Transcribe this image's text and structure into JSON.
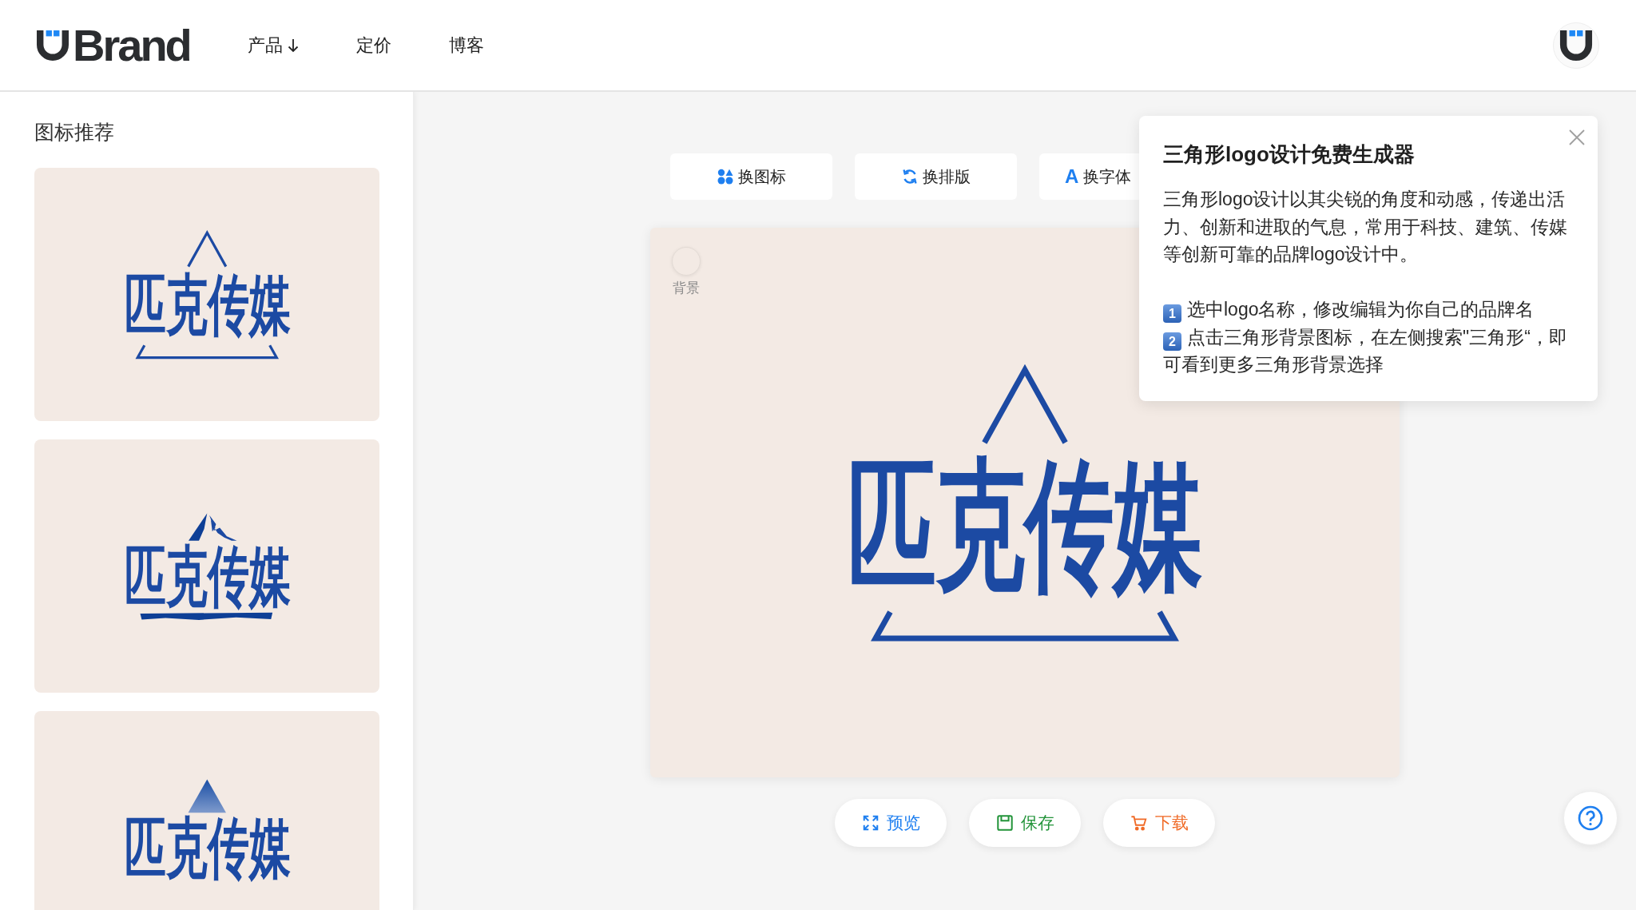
{
  "header": {
    "logo_text": "Brand",
    "nav": [
      {
        "label": "产品",
        "dropdown": true
      },
      {
        "label": "定价",
        "dropdown": false
      },
      {
        "label": "博客",
        "dropdown": false
      }
    ]
  },
  "sidebar": {
    "title": "图标推荐",
    "templates": [
      {
        "kind": "triangle",
        "brand_name": "匹克传媒"
      },
      {
        "kind": "mountain",
        "brand_name": "匹克传媒"
      },
      {
        "kind": "pyramid",
        "brand_name": "匹克传媒"
      }
    ]
  },
  "toolbar": [
    {
      "kind": "icon",
      "label": "换图标"
    },
    {
      "kind": "layout",
      "label": "换排版"
    },
    {
      "kind": "font",
      "glyph": "A",
      "label": "换字体"
    }
  ],
  "canvas": {
    "background_label": "背景",
    "logo": {
      "kind": "triangle",
      "brand_name": "匹克传媒"
    }
  },
  "actions": [
    {
      "kind": "preview",
      "label": "预览"
    },
    {
      "kind": "save",
      "label": "保存"
    },
    {
      "kind": "download",
      "label": "下载"
    }
  ],
  "popup": {
    "title": "三角形logo设计免费生成器",
    "description": "三角形logo设计以其尖锐的角度和动感，传递出活力、创新和进取的气息，常用于科技、建筑、传媒等创新可靠的品牌logo设计中。",
    "steps": [
      {
        "number": "1",
        "text": "选中logo名称，修改编辑为你自己的品牌名"
      },
      {
        "number": "2",
        "text": "点击三角形背景图标，在左侧搜索\"三角形“，即可看到更多三角形背景选择"
      }
    ]
  }
}
